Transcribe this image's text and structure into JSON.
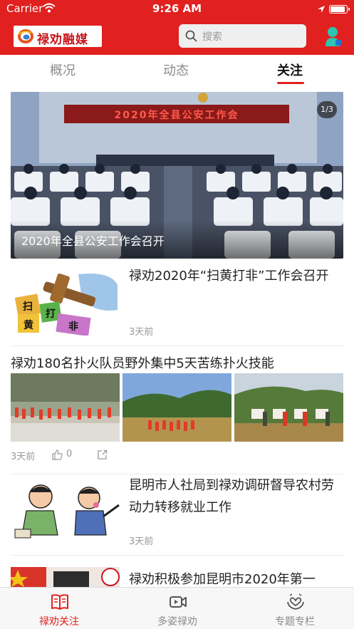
{
  "status_bar": {
    "carrier": "Carrier",
    "time": "9:26 AM",
    "wifi_icon": "wifi-icon",
    "location_icon": "location-arrow-icon",
    "battery_icon": "battery-icon"
  },
  "header": {
    "logo_text": "禄劝融媒",
    "search_placeholder": "搜索",
    "accent_color": "#e0211f"
  },
  "tabs": [
    {
      "label": "概况",
      "active": false
    },
    {
      "label": "动态",
      "active": false
    },
    {
      "label": "关注",
      "active": true
    }
  ],
  "banner": {
    "pager": "1/3",
    "caption": "2020年全县公安工作会召开",
    "screen_text": "2020年全县公安工作会"
  },
  "news": [
    {
      "title": "禄劝2020年“扫黄打非”工作会召开",
      "time": "3天前",
      "image_text": [
        "扫",
        "打",
        "黄",
        "非"
      ]
    },
    {
      "title": "禄劝180名扑火队员野外集中5天苦练扑火技能",
      "time": "3天前",
      "likes": "0"
    },
    {
      "title": "昆明市人社局到禄劝调研督导农村劳动力转移就业工作",
      "time": "3天前"
    },
    {
      "title": "禄劝积极参加昆明市2020年第一"
    }
  ],
  "bottom_nav": [
    {
      "label": "禄劝关注",
      "icon": "book-icon",
      "active": true
    },
    {
      "label": "多姿禄劝",
      "icon": "video-icon",
      "active": false
    },
    {
      "label": "专题专栏",
      "icon": "hands-heart-icon",
      "active": false
    }
  ]
}
